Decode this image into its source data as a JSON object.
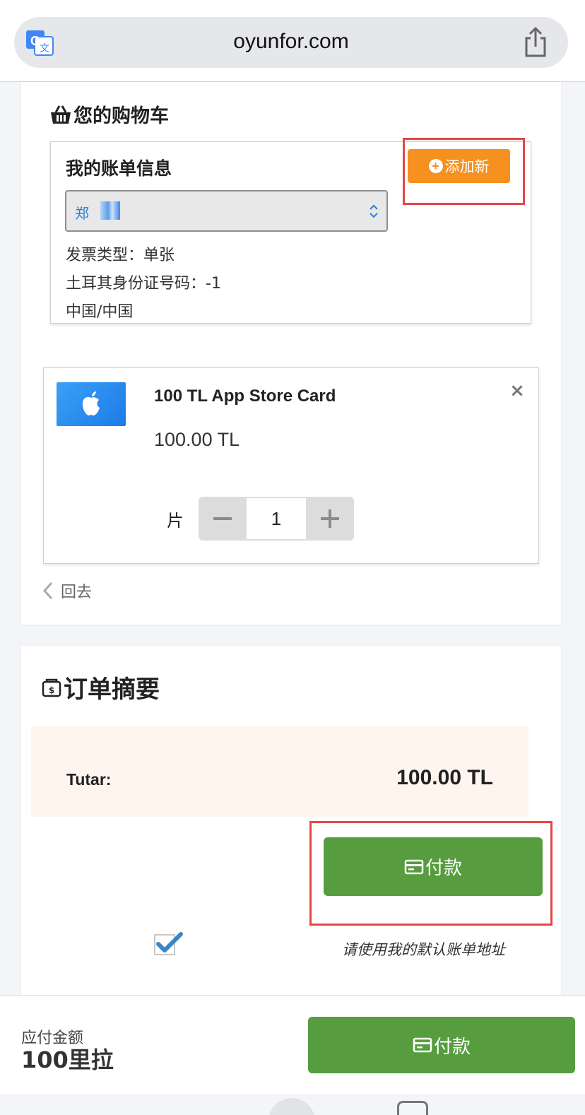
{
  "browser": {
    "url": "oyunfor.com"
  },
  "cart": {
    "title": "您的购物车",
    "billing": {
      "title": "我的账单信息",
      "add_new_label": "添加新",
      "selected_name": "郑",
      "invoice_type": "发票类型：单张",
      "tr_id": "土耳其身份证号码：-1",
      "country": "中国/中国"
    },
    "product": {
      "name": "100 TL App Store Card",
      "price": "100.00 TL",
      "qty_label": "片",
      "qty_value": "1",
      "remove_symbol": "×"
    },
    "back_label": "回去"
  },
  "summary": {
    "title": "订单摘要",
    "total_label": "Tutar:",
    "total_value": "100.00 TL",
    "pay_label": "付款",
    "default_address_label": "请使用我的默认账单地址",
    "use_default_checked": true
  },
  "bottom": {
    "due_label": "应付金额",
    "due_value": "100里拉",
    "pay_label": "付款"
  },
  "colors": {
    "orange": "#f6901e",
    "green": "#579d3f",
    "highlight": "#e64545",
    "link_blue": "#2a7fd4"
  }
}
